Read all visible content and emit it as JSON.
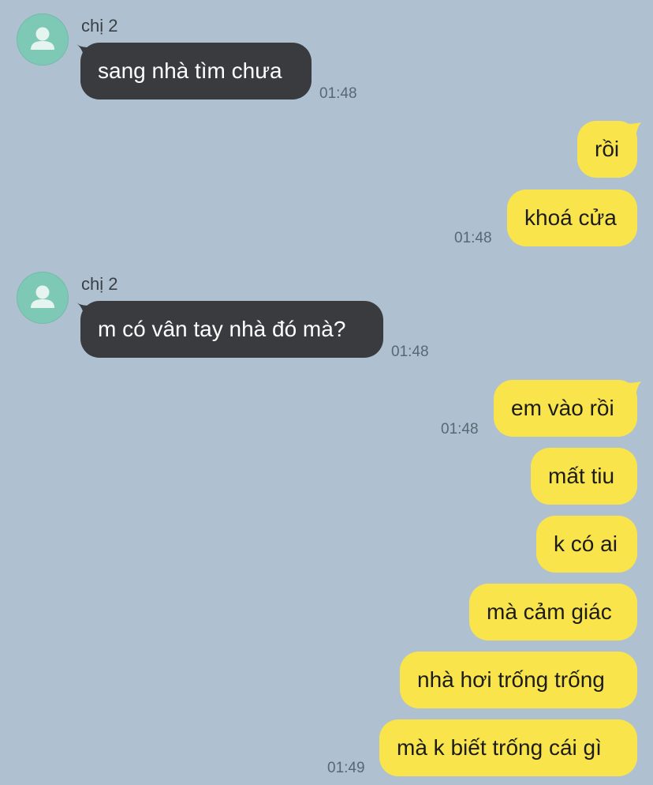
{
  "colors": {
    "background": "#afc1d1",
    "incoming_bubble": "#3a3b3f",
    "outgoing_bubble": "#f9e54b",
    "avatar": "#7ec9b5"
  },
  "messages": [
    {
      "sender": "chị 2",
      "direction": "incoming",
      "text": "sang nhà tìm chưa",
      "time": "01:48"
    },
    {
      "direction": "outgoing",
      "text": "rồi",
      "time": ""
    },
    {
      "direction": "outgoing",
      "text": "khoá cửa",
      "time": "01:48"
    },
    {
      "sender": "chị 2",
      "direction": "incoming",
      "text": "m có vân tay nhà đó mà?",
      "time": "01:48"
    },
    {
      "direction": "outgoing",
      "text": "em vào rồi",
      "time": "01:48"
    },
    {
      "direction": "outgoing",
      "text": "mất tiu",
      "time": ""
    },
    {
      "direction": "outgoing",
      "text": "k có ai",
      "time": ""
    },
    {
      "direction": "outgoing",
      "text": "mà cảm giác",
      "time": ""
    },
    {
      "direction": "outgoing",
      "text": "nhà hơi trống trống",
      "time": ""
    },
    {
      "direction": "outgoing",
      "text": "mà k biết trống cái gì",
      "time": "01:49"
    }
  ],
  "icons": {
    "avatar": "person-silhouette-icon"
  }
}
